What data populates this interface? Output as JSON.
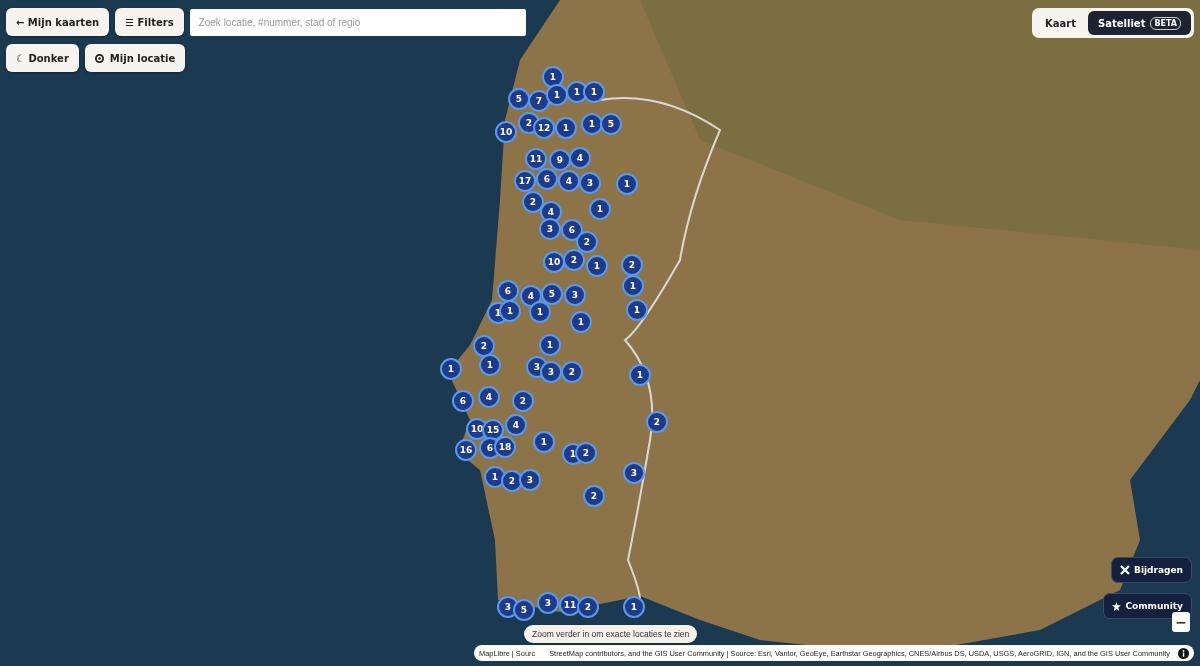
{
  "toolbar": {
    "back_button": "← Mijn kaarten",
    "filters_button": "☰ Filters",
    "search": {
      "placeholder": "Zoek locatie, #nummer, stad of regio"
    },
    "dark_button": "☾ Donker",
    "location_button": "Mijn locatie"
  },
  "map_style_toggle": [
    {
      "label": "Kaart",
      "selected": false
    },
    {
      "label": "Satelliet",
      "selected": true,
      "badge": "BETA"
    }
  ],
  "clusters": [
    "1",
    "5",
    "7",
    "1",
    "1",
    "1",
    "10",
    "2",
    "12",
    "1",
    "1",
    "5",
    "11",
    "9",
    "4",
    "17",
    "6",
    "4",
    "3",
    "1",
    "2",
    "4",
    "1",
    "3",
    "6",
    "2",
    "10",
    "2",
    "1",
    "2",
    "1",
    "6",
    "4",
    "5",
    "3",
    "1",
    "1",
    "1",
    "1",
    "1",
    "2",
    "1",
    "1",
    "1",
    "3",
    "3",
    "2",
    "1",
    "6",
    "4",
    "2",
    "10",
    "15",
    "4",
    "2",
    "16",
    "6",
    "18",
    "1",
    "1",
    "2",
    "1",
    "2",
    "3",
    "3",
    "2",
    "3",
    "5",
    "3",
    "11",
    "2",
    "1"
  ],
  "side_buttons": [
    "Bijdragen",
    "Community"
  ],
  "zoom_out": "−",
  "hint": "Zoom verder in om exacte locaties te zien",
  "attribution": {
    "left": "MapLibre | Sourc",
    "right": "StreetMap contributors, and the GIS User Community | Source: Esri, Vantor, GeoEye, Earthstar Geographics, CNES/Airbus DS, USDA, USGS, AeroGRID, IGN, and the GIS User Community"
  }
}
